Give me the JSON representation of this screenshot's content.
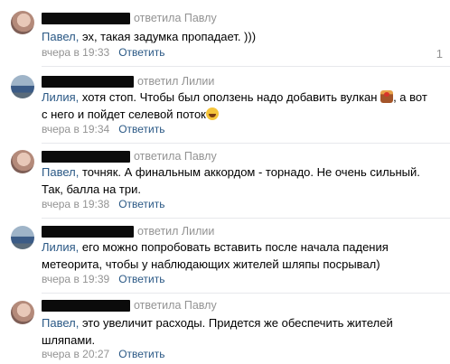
{
  "comments": [
    {
      "verb": "ответила Павлу",
      "mention": "Павел,",
      "lines": [
        " эх, такая задумка пропадает. )))"
      ],
      "time": "вчера в 19:33",
      "reply": "Ответить",
      "like_count": "1"
    },
    {
      "verb": "ответил Лилии",
      "mention": "Лилия,",
      "line1": " хотя стоп. Чтобы был оползень надо добавить вулкан ",
      "line1b": ", а вот",
      "line2": "с него и пойдет селевой поток",
      "time": "вчера в 19:34",
      "reply": "Ответить"
    },
    {
      "verb": "ответила Павлу",
      "mention": "Павел,",
      "line1": " точняк. А финальным аккордом - торнадо. Не очень сильный.",
      "line2": "Так, балла на три.",
      "time": "вчера в 19:38",
      "reply": "Ответить"
    },
    {
      "verb": "ответил Лилии",
      "mention": "Лилия,",
      "line1": " его можно попробовать вставить после начала падения",
      "line2": "метеорита, чтобы у наблюдающих жителей шляпы посрывал)",
      "time": "вчера в 19:39",
      "reply": "Ответить"
    },
    {
      "verb": "ответила Павлу",
      "mention": "Павел,",
      "line1": " это увеличит расходы. Придется же обеспечить жителей",
      "line2": "шляпами.",
      "time": "вчера в 20:27",
      "reply": "Ответить"
    }
  ]
}
